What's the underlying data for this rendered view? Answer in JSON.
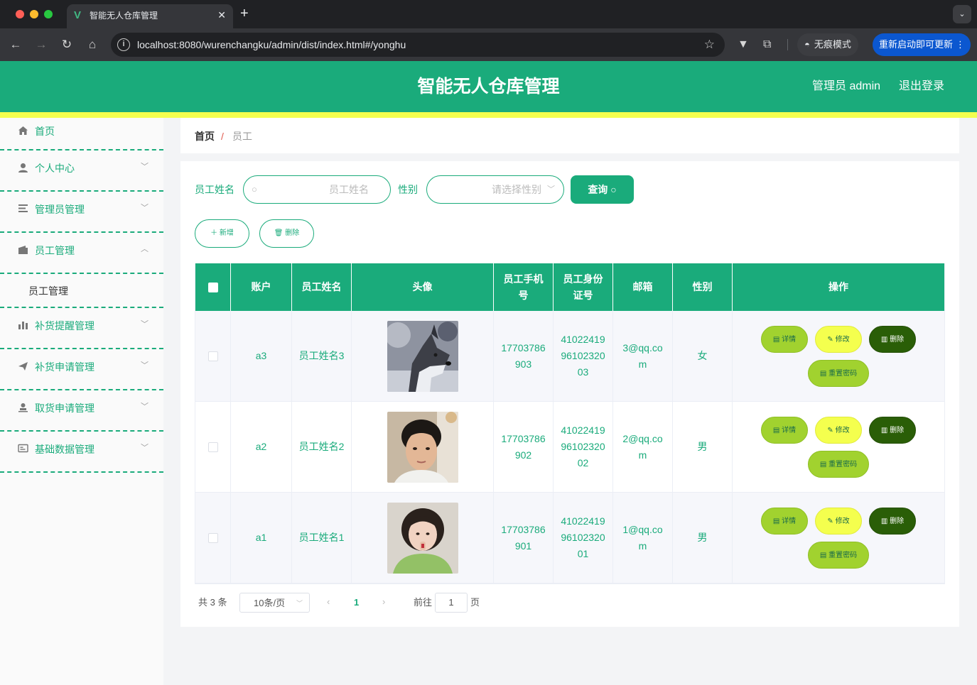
{
  "browser": {
    "tab_title": "智能无人仓库管理",
    "url": "localhost:8080/wurenchangku/admin/dist/index.html#/yonghu",
    "incognito_label": "无痕模式",
    "update_label": "重新启动即可更新"
  },
  "header": {
    "title": "智能无人仓库管理",
    "admin_label": "管理员 admin",
    "logout_label": "退出登录",
    "colors": {
      "primary": "#1aab7b",
      "stripe": "#f4ff4e"
    }
  },
  "sidebar": {
    "items": [
      {
        "label": "首页",
        "icon": "home-icon"
      },
      {
        "label": "个人中心",
        "icon": "user-icon"
      },
      {
        "label": "管理员管理",
        "icon": "list-icon"
      },
      {
        "label": "员工管理",
        "icon": "wallet-icon",
        "expanded": true,
        "children": [
          {
            "label": "员工管理"
          }
        ]
      },
      {
        "label": "补货提醒管理",
        "icon": "bar-chart-icon"
      },
      {
        "label": "补货申请管理",
        "icon": "send-icon"
      },
      {
        "label": "取货申请管理",
        "icon": "person-stamp-icon"
      },
      {
        "label": "基础数据管理",
        "icon": "id-card-icon"
      }
    ]
  },
  "breadcrumb": {
    "home": "首页",
    "separator": "/",
    "current": "员工"
  },
  "search": {
    "name_label": "员工姓名",
    "name_placeholder": "员工姓名",
    "gender_label": "性别",
    "gender_placeholder": "请选择性别",
    "query_label": "查询"
  },
  "actions": {
    "add_label": "新增",
    "delete_label": "删除"
  },
  "table": {
    "columns": [
      "账户",
      "员工姓名",
      "头像",
      "员工手机号",
      "员工身份证号",
      "邮箱",
      "性别",
      "操作"
    ],
    "rows": [
      {
        "account": "a3",
        "name": "员工姓名3",
        "avatar": "husky-photo",
        "phone": "17703786903",
        "id_number": "410224199610232003",
        "email": "3@qq.com",
        "gender": "女"
      },
      {
        "account": "a2",
        "name": "员工姓名2",
        "avatar": "young-man-photo",
        "phone": "17703786902",
        "id_number": "410224199610232002",
        "email": "2@qq.com",
        "gender": "男"
      },
      {
        "account": "a1",
        "name": "员工姓名1",
        "avatar": "young-woman-photo",
        "phone": "17703786901",
        "id_number": "410224199610232001",
        "email": "1@qq.com",
        "gender": "男"
      }
    ],
    "row_actions": {
      "detail": "详情",
      "edit": "修改",
      "delete": "删除",
      "reset": "重置密码"
    }
  },
  "pagination": {
    "total_text": "共 3 条",
    "page_size": "10条/页",
    "current_page": "1",
    "goto_label": "前往",
    "goto_value": "1",
    "page_unit": "页"
  }
}
